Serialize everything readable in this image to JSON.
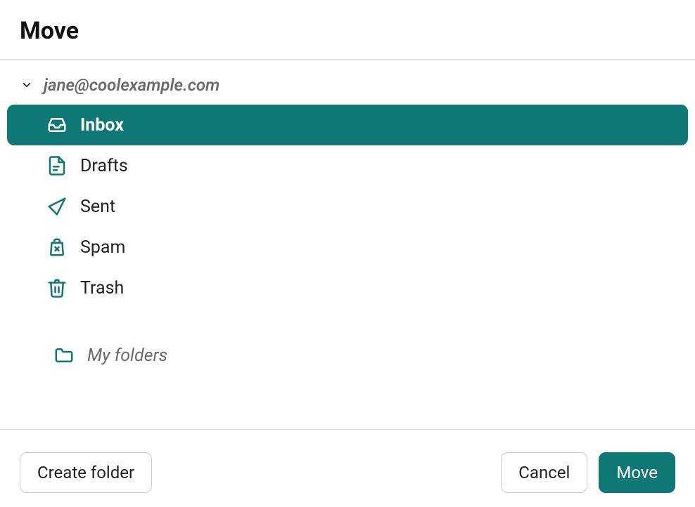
{
  "dialog": {
    "title": "Move"
  },
  "account": {
    "email": "jane@coolexample.com"
  },
  "folders": {
    "inbox": "Inbox",
    "drafts": "Drafts",
    "sent": "Sent",
    "spam": "Spam",
    "trash": "Trash",
    "myfolders": "My folders"
  },
  "buttons": {
    "create_folder": "Create folder",
    "cancel": "Cancel",
    "move": "Move"
  },
  "colors": {
    "accent": "#0e7874"
  }
}
